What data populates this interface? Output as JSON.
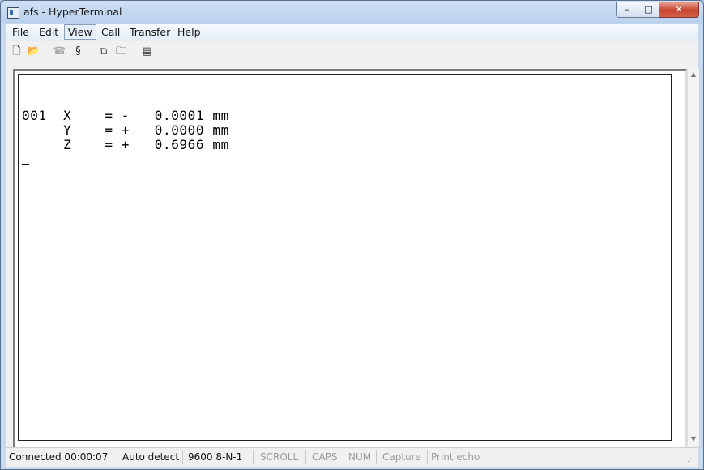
{
  "window": {
    "title": "afs - HyperTerminal"
  },
  "window_buttons": {
    "minimize": "–",
    "maximize": "□",
    "close": "✕"
  },
  "menu": [
    {
      "label": "File"
    },
    {
      "label": "Edit"
    },
    {
      "label": "View"
    },
    {
      "label": "Call"
    },
    {
      "label": "Transfer"
    },
    {
      "label": "Help"
    }
  ],
  "toolbar": [
    {
      "icon": "new-document-icon",
      "glyph": "🗋"
    },
    {
      "icon": "open-folder-icon",
      "glyph": "📂"
    },
    {
      "icon": "disconnect-icon",
      "glyph": "☎"
    },
    {
      "icon": "dial-icon",
      "glyph": "§"
    },
    {
      "icon": "send-icon",
      "glyph": "⧉"
    },
    {
      "icon": "receive-icon",
      "glyph": "🗀"
    },
    {
      "icon": "properties-icon",
      "glyph": "▤"
    }
  ],
  "terminal": {
    "lines": [
      "001  X    = -   0.0001 mm",
      "     Y    = +   0.0000 mm",
      "     Z    = +   0.6966 mm"
    ]
  },
  "statusbar": {
    "connected": "Connected 00:00:07",
    "detect": "Auto detect",
    "params": "9600 8-N-1",
    "scroll": "SCROLL",
    "caps": "CAPS",
    "num": "NUM",
    "capture": "Capture",
    "print_echo": "Print echo"
  },
  "scrollbar": {
    "up": "▲",
    "down": "▼"
  }
}
